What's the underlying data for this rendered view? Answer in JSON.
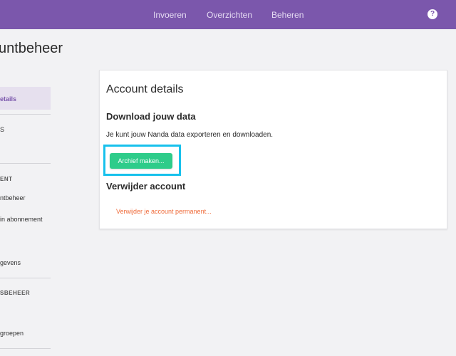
{
  "topbar": {
    "nav": [
      "Invoeren",
      "Overzichten",
      "Beheren"
    ],
    "help_icon": "?"
  },
  "page": {
    "title": "untbeheer"
  },
  "sidebar": {
    "items": [
      {
        "label": "etails",
        "active": true
      },
      {
        "label": "S"
      },
      {
        "header": "ENT"
      },
      {
        "label": "ntbeheer"
      },
      {
        "label": "in abonnement"
      },
      {
        "label": "gevens"
      },
      {
        "header": "SBEHEER"
      },
      {
        "label": "groepen"
      }
    ]
  },
  "card": {
    "title": "Account details",
    "download": {
      "heading": "Download jouw data",
      "text": "Je kunt jouw Nanda data exporteren en downloaden.",
      "button": "Archief maken..."
    },
    "delete": {
      "heading": "Verwijder account",
      "link": "Verwijder je account permanent..."
    }
  },
  "colors": {
    "topbar": "#7b57ac",
    "accent_green": "#2ecc8a",
    "highlight": "#17c1ec",
    "danger": "#ef6b3a"
  }
}
